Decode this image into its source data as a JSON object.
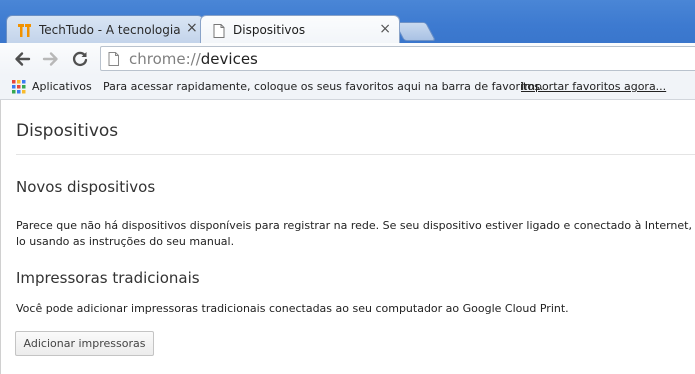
{
  "tabs": [
    {
      "title": "TechTudo - A tecnologia que você usa",
      "active": false,
      "icon": "techtudo-favicon"
    },
    {
      "title": "Dispositivos",
      "active": true,
      "icon": "page-icon"
    }
  ],
  "tab_close_symbol": "×",
  "toolbar": {
    "url_scheme": "chrome://",
    "url_path": "devices"
  },
  "bookmarks_bar": {
    "apps_label": "Aplicativos",
    "hint": "Para acessar rapidamente, coloque os seus favoritos aqui na barra de favoritos.",
    "import_link": "Importar favoritos agora..."
  },
  "page": {
    "title": "Dispositivos",
    "new_devices": {
      "heading": "Novos dispositivos",
      "text": "Parece que não há dispositivos disponíveis para registrar na rede. Se seu dispositivo estiver ligado e conectado à Internet, tente registrá-\nlo usando as instruções do seu manual."
    },
    "classic_printers": {
      "heading": "Impressoras tradicionais",
      "text": "Você pode adicionar impressoras tradicionais conectadas ao seu computador ao Google Cloud Print.",
      "button": "Adicionar impressoras"
    }
  },
  "colors": {
    "tabstrip": "#3d7ad0",
    "techtudo_orange": "#f29200",
    "reload_blue": "#3b3b3b"
  }
}
